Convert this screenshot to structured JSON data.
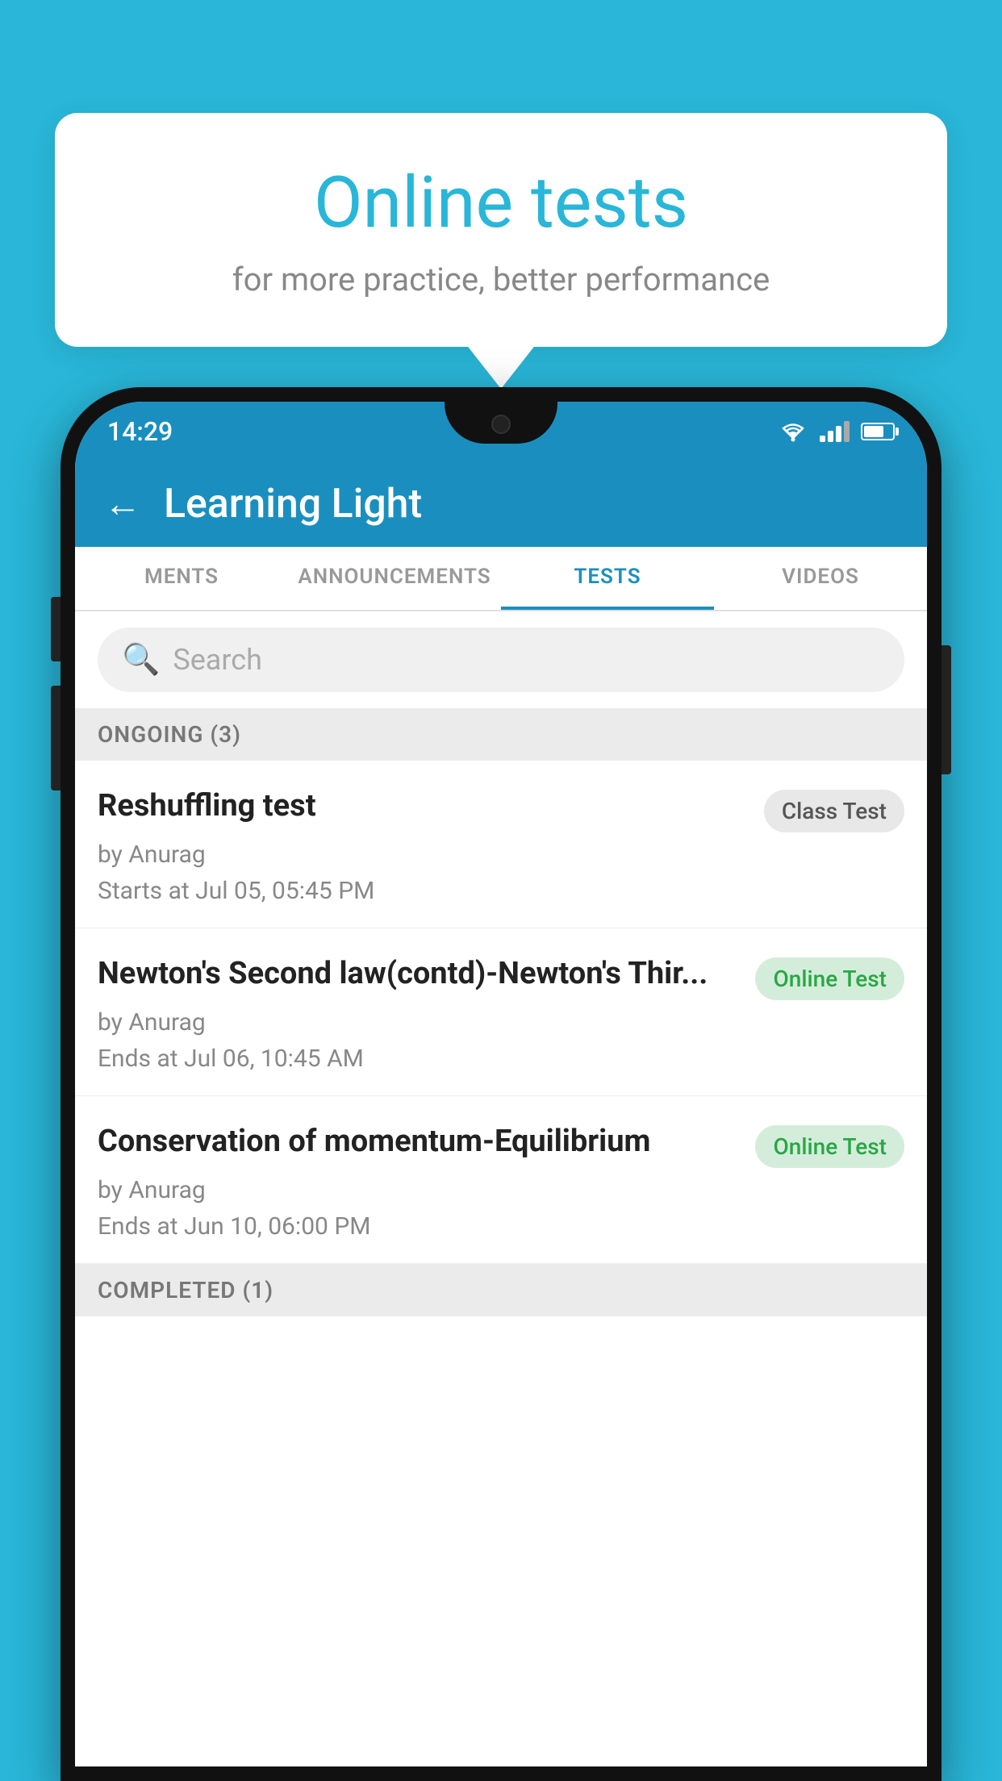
{
  "background_color": "#29b6d8",
  "bubble": {
    "title": "Online tests",
    "subtitle": "for more practice, better performance"
  },
  "status_bar": {
    "time": "14:29"
  },
  "app_header": {
    "title": "Learning Light",
    "back_label": "←"
  },
  "tabs": [
    {
      "label": "MENTS",
      "active": false
    },
    {
      "label": "ANNOUNCEMENTS",
      "active": false
    },
    {
      "label": "TESTS",
      "active": true
    },
    {
      "label": "VIDEOS",
      "active": false
    }
  ],
  "search": {
    "placeholder": "Search"
  },
  "ongoing_section": {
    "label": "ONGOING (3)"
  },
  "tests": [
    {
      "name": "Reshuffling test",
      "badge": "Class Test",
      "badge_type": "class",
      "by": "by Anurag",
      "time": "Starts at  Jul 05, 05:45 PM"
    },
    {
      "name": "Newton's Second law(contd)-Newton's Thir...",
      "badge": "Online Test",
      "badge_type": "online",
      "by": "by Anurag",
      "time": "Ends at  Jul 06, 10:45 AM"
    },
    {
      "name": "Conservation of momentum-Equilibrium",
      "badge": "Online Test",
      "badge_type": "online",
      "by": "by Anurag",
      "time": "Ends at  Jun 10, 06:00 PM"
    }
  ],
  "completed_section": {
    "label": "COMPLETED (1)"
  }
}
